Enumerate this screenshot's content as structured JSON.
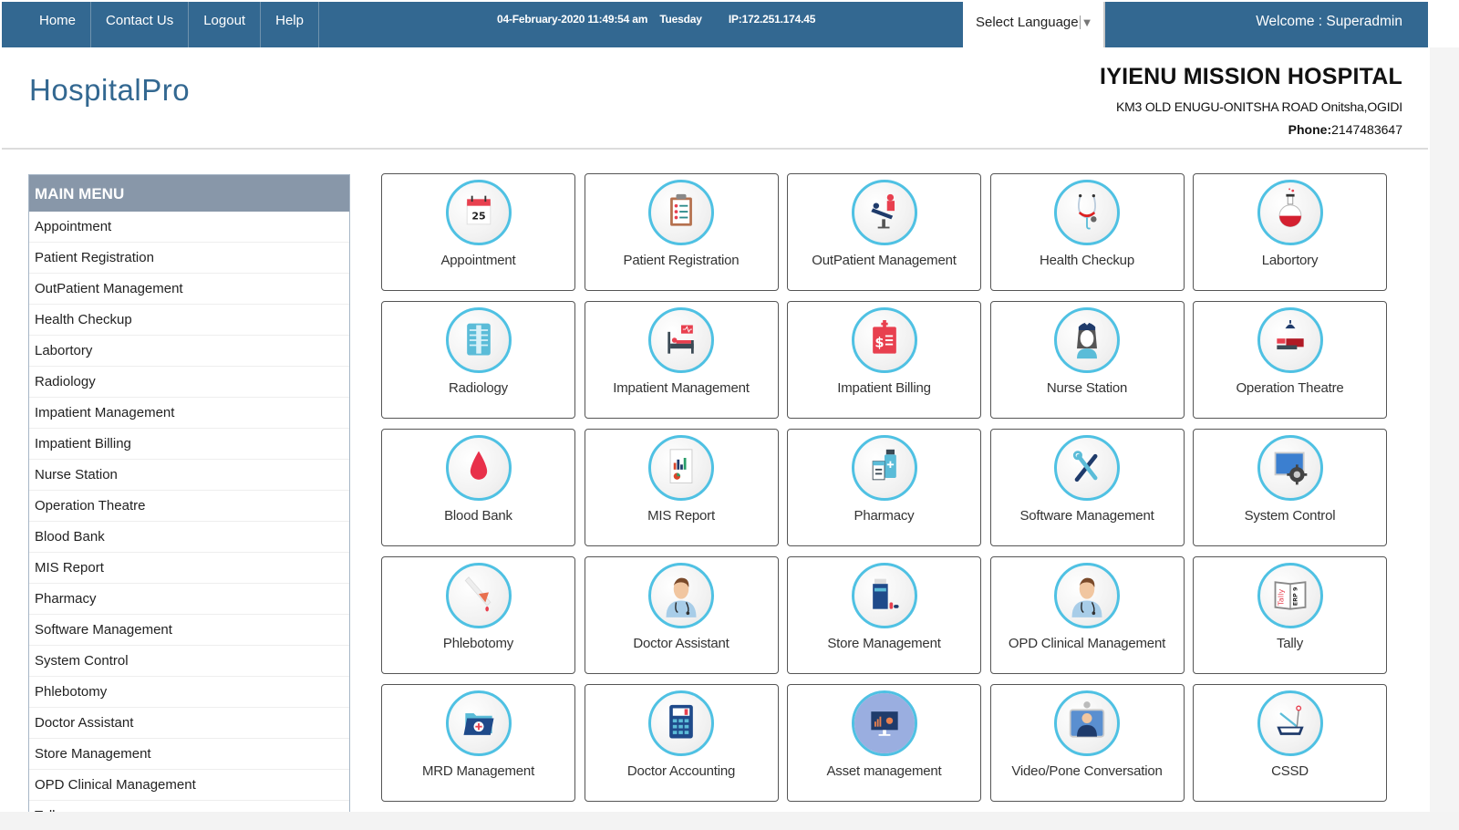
{
  "topbar": {
    "nav": [
      "Home",
      "Contact Us",
      "Logout",
      "Help"
    ],
    "date": "04-February-2020 11:49:54 am",
    "day": "Tuesday",
    "ip": "IP:172.251.174.45",
    "language_select": "Select Language",
    "welcome": "Welcome : Superadmin"
  },
  "header": {
    "brand": "HospitalPro",
    "hospital_name": "IYIENU MISSION HOSPITAL",
    "address": "KM3 OLD ENUGU-ONITSHA ROAD Onitsha,OGIDI",
    "phone_label": "Phone:",
    "phone": "2147483647"
  },
  "sidebar": {
    "title": "MAIN MENU",
    "items": [
      "Appointment",
      "Patient Registration",
      "OutPatient Management",
      "Health Checkup",
      "Labortory",
      "Radiology",
      "Impatient Management",
      "Impatient Billing",
      "Nurse Station",
      "Operation Theatre",
      "Blood Bank",
      "MIS Report",
      "Pharmacy",
      "Software Management",
      "System Control",
      "Phlebotomy",
      "Doctor Assistant",
      "Store Management",
      "OPD Clinical Management",
      "Tally"
    ]
  },
  "tiles": [
    {
      "label": "Appointment",
      "icon": "calendar-icon"
    },
    {
      "label": "Patient Registration",
      "icon": "clipboard-icon"
    },
    {
      "label": "OutPatient Management",
      "icon": "dental-chair-icon"
    },
    {
      "label": "Health Checkup",
      "icon": "stethoscope-icon"
    },
    {
      "label": "Labortory",
      "icon": "flask-icon"
    },
    {
      "label": "Radiology",
      "icon": "xray-icon"
    },
    {
      "label": "Impatient Management",
      "icon": "hospital-bed-icon"
    },
    {
      "label": "Impatient Billing",
      "icon": "bill-icon"
    },
    {
      "label": "Nurse Station",
      "icon": "nurse-icon"
    },
    {
      "label": "Operation Theatre",
      "icon": "operation-icon"
    },
    {
      "label": "Blood Bank",
      "icon": "blood-drop-icon"
    },
    {
      "label": "MIS Report",
      "icon": "report-chart-icon"
    },
    {
      "label": "Pharmacy",
      "icon": "medicine-bottle-icon"
    },
    {
      "label": "Software Management",
      "icon": "tools-icon"
    },
    {
      "label": "System Control",
      "icon": "gear-screen-icon"
    },
    {
      "label": "Phlebotomy",
      "icon": "syringe-icon"
    },
    {
      "label": "Doctor Assistant",
      "icon": "doctor-icon"
    },
    {
      "label": "Store Management",
      "icon": "medicine-store-icon"
    },
    {
      "label": "OPD Clinical Management",
      "icon": "doctor-icon"
    },
    {
      "label": "Tally",
      "icon": "tally-book-icon"
    },
    {
      "label": "MRD Management",
      "icon": "medical-folder-icon"
    },
    {
      "label": "Doctor Accounting",
      "icon": "calculator-icon"
    },
    {
      "label": "Asset management",
      "icon": "monitor-chart-icon"
    },
    {
      "label": "Video/Pone Conversation",
      "icon": "video-call-icon"
    },
    {
      "label": "CSSD",
      "icon": "sterilization-tray-icon"
    }
  ],
  "colors": {
    "topbar": "#336891",
    "brand": "#336891",
    "sidebar_header": "#8897a9",
    "icon_ring": "#4fc1e3"
  }
}
